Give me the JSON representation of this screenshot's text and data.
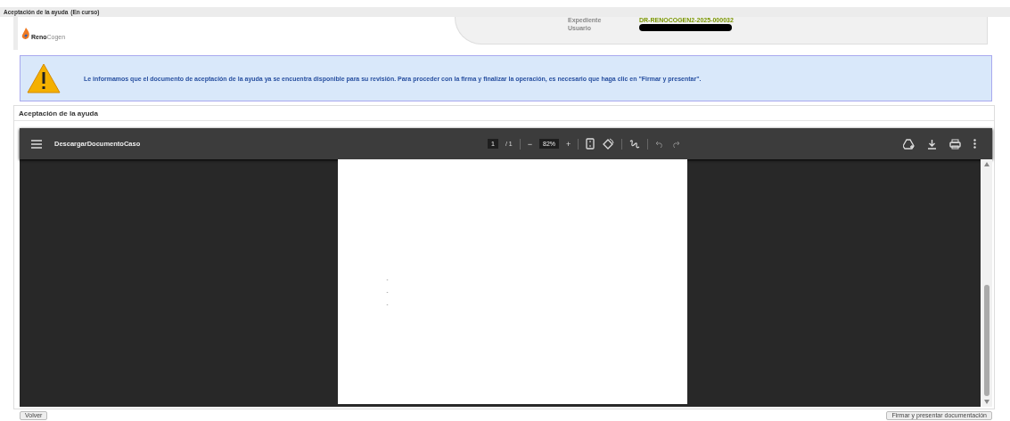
{
  "window": {
    "title": "Aceptación de la ayuda",
    "status": "(En curso)"
  },
  "header": {
    "logo": {
      "bold": "Reno",
      "light": "Cogen"
    },
    "fields": [
      {
        "label": "Expediente",
        "value": "DR-RENOCOGEN2-2025-000032",
        "redacted": false
      },
      {
        "label": "Usuario",
        "redacted": true
      }
    ]
  },
  "alert": {
    "message": "Le informamos que el documento de aceptación de la ayuda ya se encuentra disponible para su revisión. Para proceder con la firma y finalizar la operación, es necesario que haga clic en \"Firmar y presentar\"."
  },
  "section": {
    "title": "Aceptación de la ayuda"
  },
  "pdf_viewer": {
    "file_name": "DescargarDocumentoCaso",
    "page": "1",
    "pages": "/ 1",
    "zoom": "82%",
    "minus": "−",
    "plus": "+",
    "page_marks": [
      "-",
      "-",
      "-"
    ]
  },
  "buttons": [
    {
      "label": "Volver",
      "kind": "left"
    },
    {
      "label": "Firmar y presentar documentación",
      "kind": "right"
    }
  ]
}
